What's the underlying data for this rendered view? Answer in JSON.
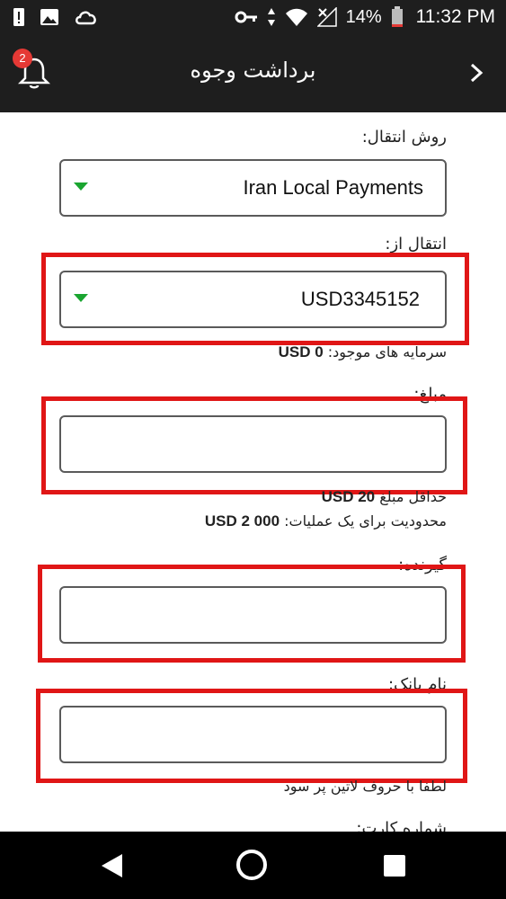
{
  "status_bar": {
    "battery": "14%",
    "time": "11:32 PM",
    "icons": [
      "alert-icon",
      "image-icon",
      "cloud-icon",
      "vpn-key-icon",
      "data-arrows-icon",
      "wifi-icon",
      "no-signal-icon",
      "battery-icon"
    ]
  },
  "app_bar": {
    "title": "برداشت وجوه",
    "notification_count": "2"
  },
  "form": {
    "transfer_method": {
      "label": "روش انتقال:",
      "value": "Iran Local Payments"
    },
    "transfer_from": {
      "label": "انتقال از:",
      "value": "USD3345152",
      "balance_label": "سرمایه های موجود:",
      "balance_value": "USD 0"
    },
    "amount": {
      "label": "مبلغ:",
      "value": "",
      "min_label": "حداقل مبلغ",
      "min_value": "USD 20",
      "limit_label": "محدودیت برای یک عملیات:",
      "limit_value": "USD 2 000"
    },
    "recipient": {
      "label": "گیرنده:",
      "value": ""
    },
    "bank_name": {
      "label": "نام بانک:",
      "value": "",
      "hint": "لطفا با حروف لاتین پر سود"
    },
    "card_number": {
      "label": "شماره کارت:"
    }
  },
  "colors": {
    "header_bg": "#1e1e1e",
    "highlight": "#e01616",
    "dropdown_arrow": "#1aa530",
    "badge": "#e53935"
  }
}
